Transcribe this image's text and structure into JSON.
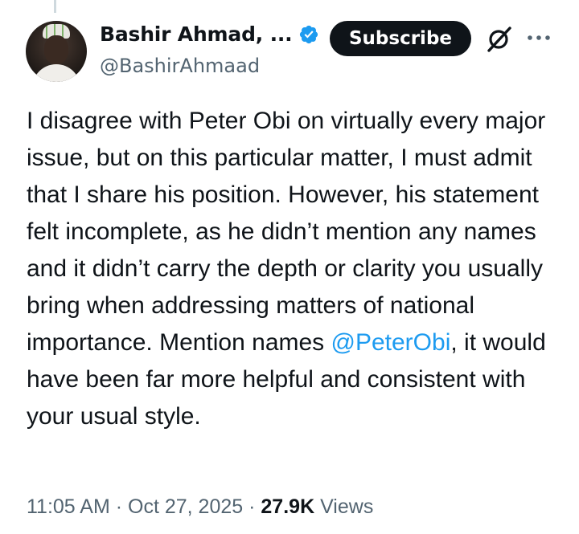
{
  "author": {
    "display_name": "Bashir Ahmad, ...",
    "handle": "@BashirAhmaad",
    "verified": true
  },
  "actions": {
    "subscribe_label": "Subscribe",
    "grok_icon": "grok-icon",
    "more_icon": "more-icon"
  },
  "tweet": {
    "text_before": "I disagree with Peter Obi on virtually every major issue, but on this particular matter, I must admit that I share his position. However, his statement felt incomplete, as he didn’t mention any names and it didn’t carry the depth or clarity you usually bring when addressing matters of national importance. Mention names ",
    "mention": "@PeterObi",
    "text_after": ", it would have been far more helpful and consistent with your usual style."
  },
  "meta": {
    "time": "11:05 AM",
    "separator": "·",
    "date": "Oct 27, 2025",
    "views_count": "27.9K",
    "views_label": "Views"
  },
  "colors": {
    "text": "#0f1419",
    "secondary": "#536471",
    "accent": "#1d9bf0",
    "button_bg": "#0f1419"
  }
}
